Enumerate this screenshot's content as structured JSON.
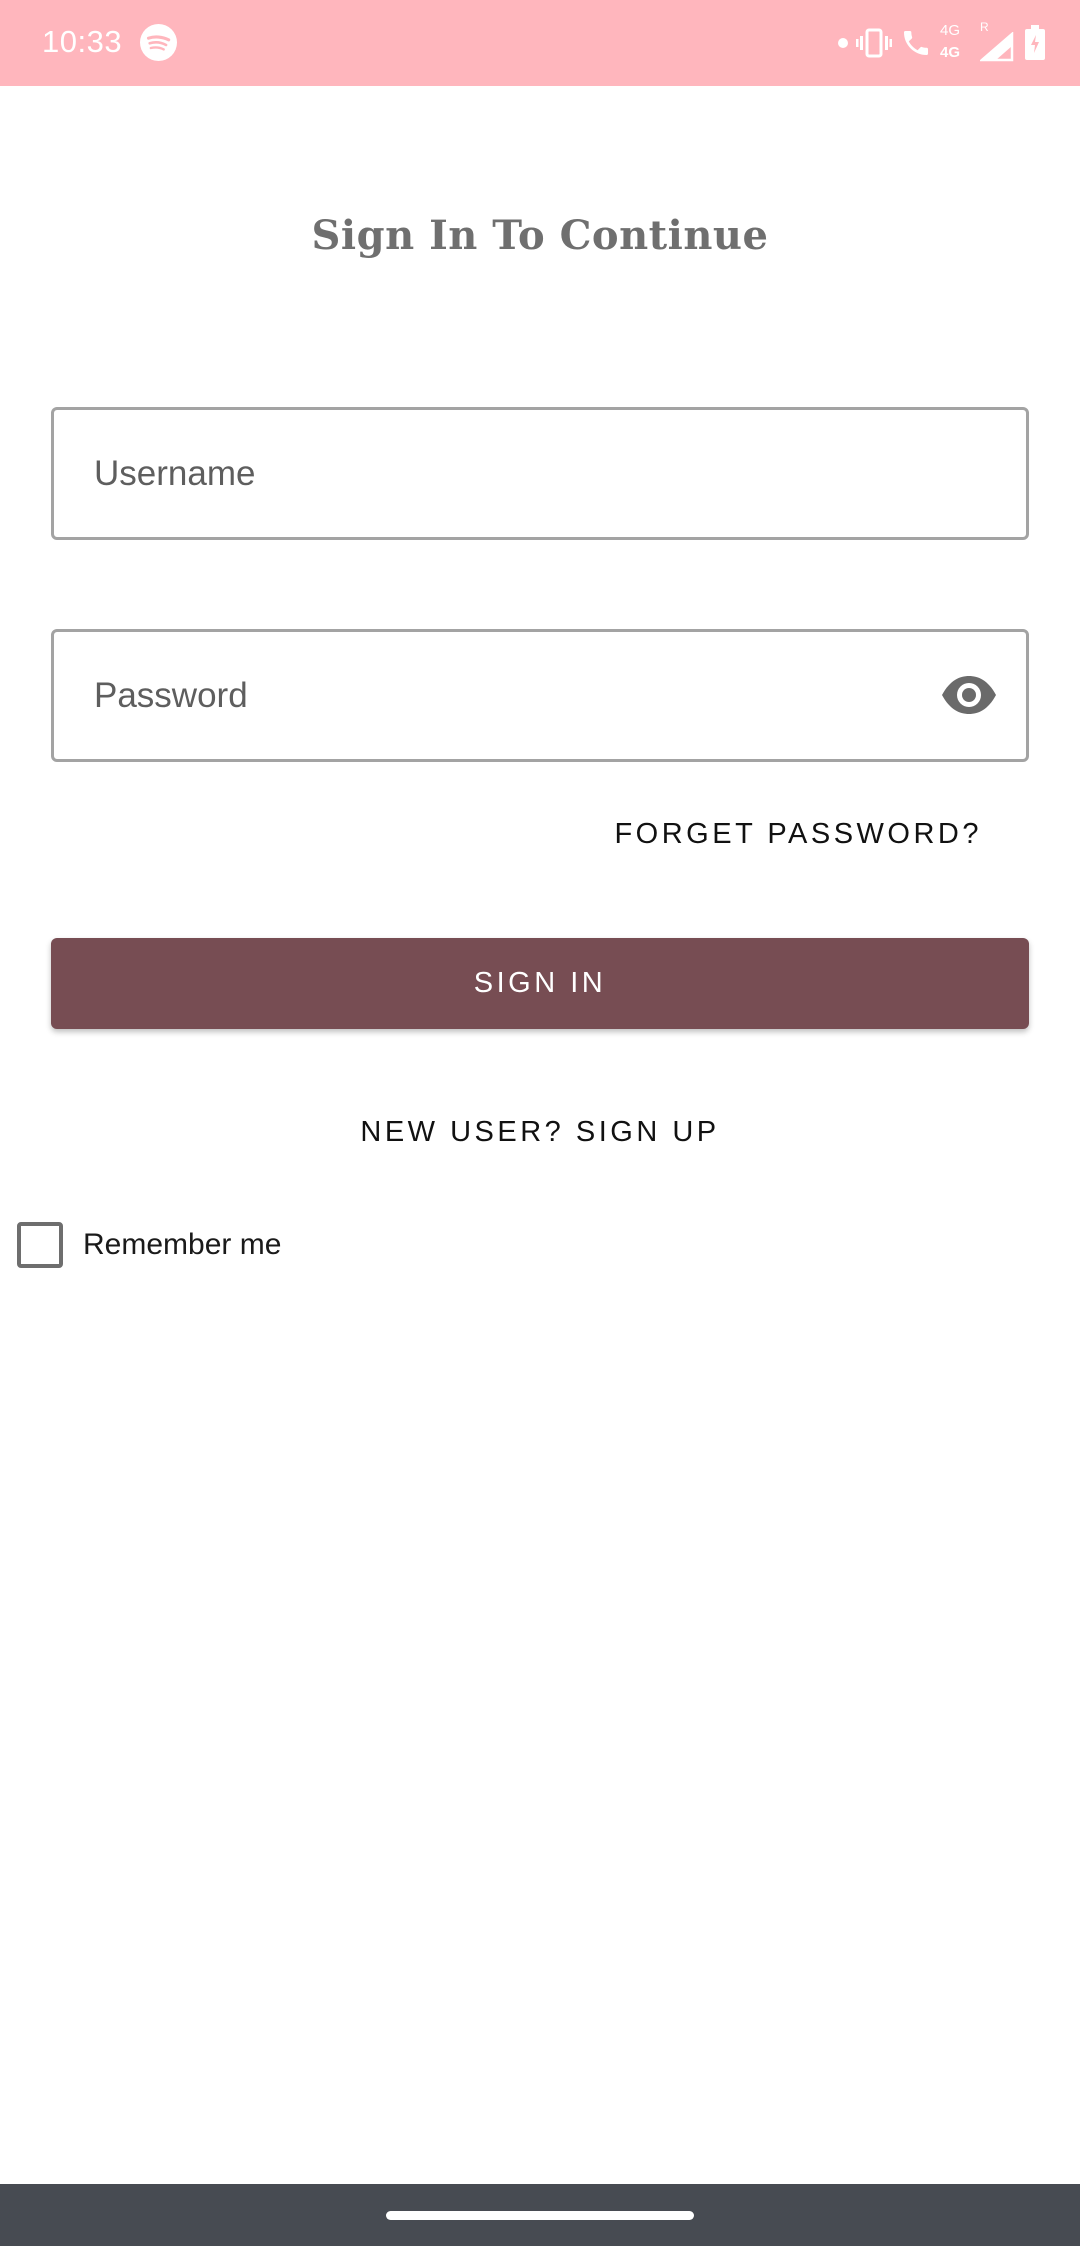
{
  "status_bar": {
    "time": "10:33",
    "background": "#ffb6bd",
    "icons": [
      "spotify-icon",
      "notification-dot-icon",
      "vibrate-icon",
      "volte-call-icon",
      "signal-4g-icon",
      "signal-roaming-icon",
      "battery-charging-icon"
    ],
    "network_label_top": "4G",
    "network_label_bottom": "4G",
    "roaming_label": "R"
  },
  "screen": {
    "title": "Sign In To Continue"
  },
  "form": {
    "username_placeholder": "Username",
    "password_placeholder": "Password",
    "password_toggle_icon": "eye-icon",
    "forget_password_label": "FORGET PASSWORD?",
    "sign_in_label": "SIGN IN",
    "sign_up_label": "NEW USER? SIGN UP",
    "remember_me_label": "Remember me",
    "remember_me_checked": false
  },
  "colors": {
    "accent": "#774d53",
    "status_bar": "#ffb6bd",
    "nav_bar": "#474b52"
  }
}
